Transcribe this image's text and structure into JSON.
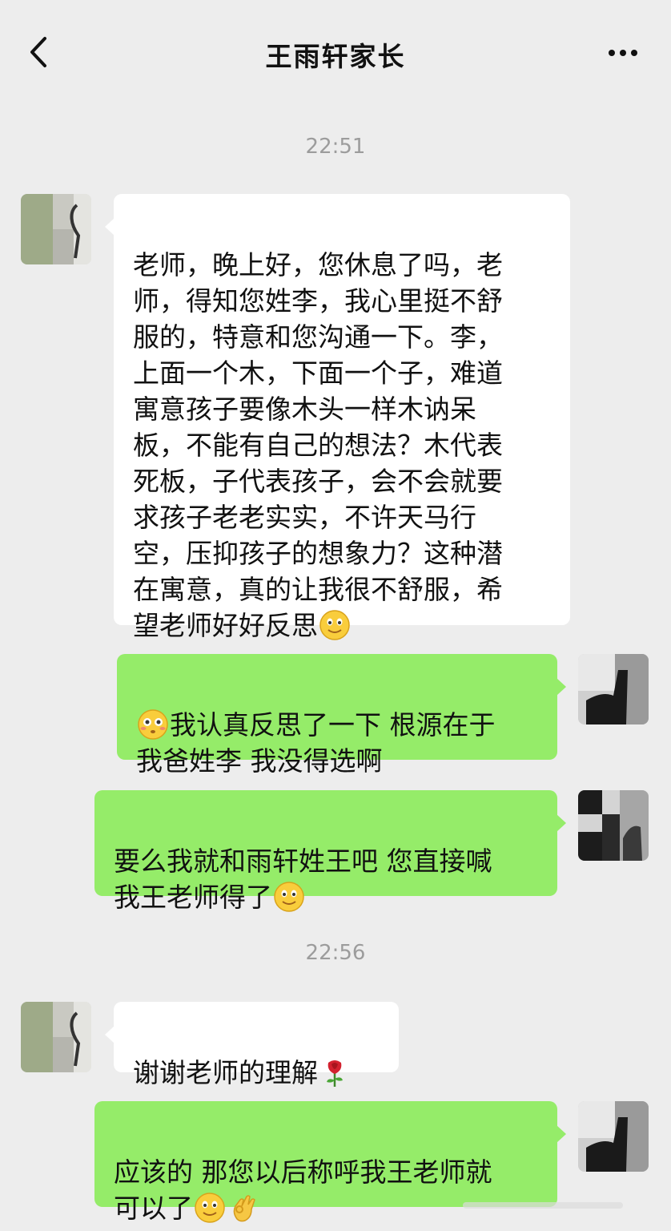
{
  "header": {
    "title": "王雨轩家长",
    "back_icon": "chevron-left-icon",
    "more_icon": "more-dots-icon"
  },
  "messages": [
    {
      "type": "time",
      "text": "22:51"
    },
    {
      "type": "in",
      "text": "老师，晚上好，您休息了吗，老\n师，得知您姓李，我心里挺不舒\n服的，特意和您沟通一下。李，\n上面一个木，下面一个子，难道\n寓意孩子要像木头一样木讷呆\n板，不能有自己的想法？木代表\n死板，子代表孩子，会不会就要\n求孩子老老实实，不许天马行\n空，压抑孩子的想象力？这种潜\n在寓意，真的让我很不舒服，希\n望老师好好反思",
      "trailing_emoji": "smile-emoji"
    },
    {
      "type": "out",
      "leading_emoji": "flushed-emoji",
      "text": "我认真反思了一下 根源在于\n我爸姓李 我没得选啊"
    },
    {
      "type": "out",
      "text": "要么我就和雨轩姓王吧 您直接喊\n我王老师得了",
      "trailing_emoji": "smile-emoji"
    },
    {
      "type": "time",
      "text": "22:56"
    },
    {
      "type": "in",
      "text": "谢谢老师的理解",
      "trailing_emoji": "rose-emoji"
    },
    {
      "type": "out",
      "text": "应该的 那您以后称呼我王老师就\n可以了",
      "trailing_emoji": "smile-emoji,ok-hand-emoji"
    }
  ],
  "colors": {
    "background": "#ededed",
    "incoming_bubble": "#ffffff",
    "outgoing_bubble": "#95ec69",
    "timestamp": "#9c9c9c"
  }
}
